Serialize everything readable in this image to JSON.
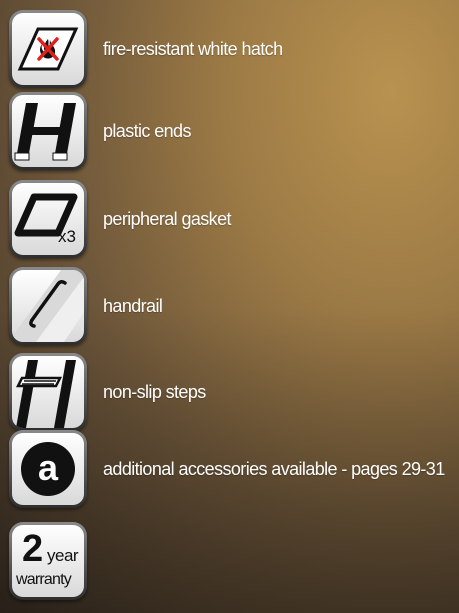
{
  "features": [
    {
      "icon": "fire-resistant-hatch-icon",
      "label": "fire-resistant white hatch"
    },
    {
      "icon": "plastic-ends-icon",
      "label": "plastic ends"
    },
    {
      "icon": "peripheral-gasket-icon",
      "label": "peripheral gasket",
      "badge": "x3"
    },
    {
      "icon": "handrail-icon",
      "label": "handrail"
    },
    {
      "icon": "non-slip-steps-icon",
      "label": "non-slip steps"
    },
    {
      "icon": "accessories-icon",
      "label": "additional accessories available - pages 29-31",
      "letter": "a"
    },
    {
      "icon": "warranty-icon",
      "number": "2",
      "unit": "year",
      "word": "warranty"
    }
  ],
  "colors": {
    "tile_frame": "#5a5a5a",
    "tile_face": "#ffffff",
    "icon_ink": "#111111",
    "fire_red": "#e0201b",
    "text": "#ffffff"
  }
}
